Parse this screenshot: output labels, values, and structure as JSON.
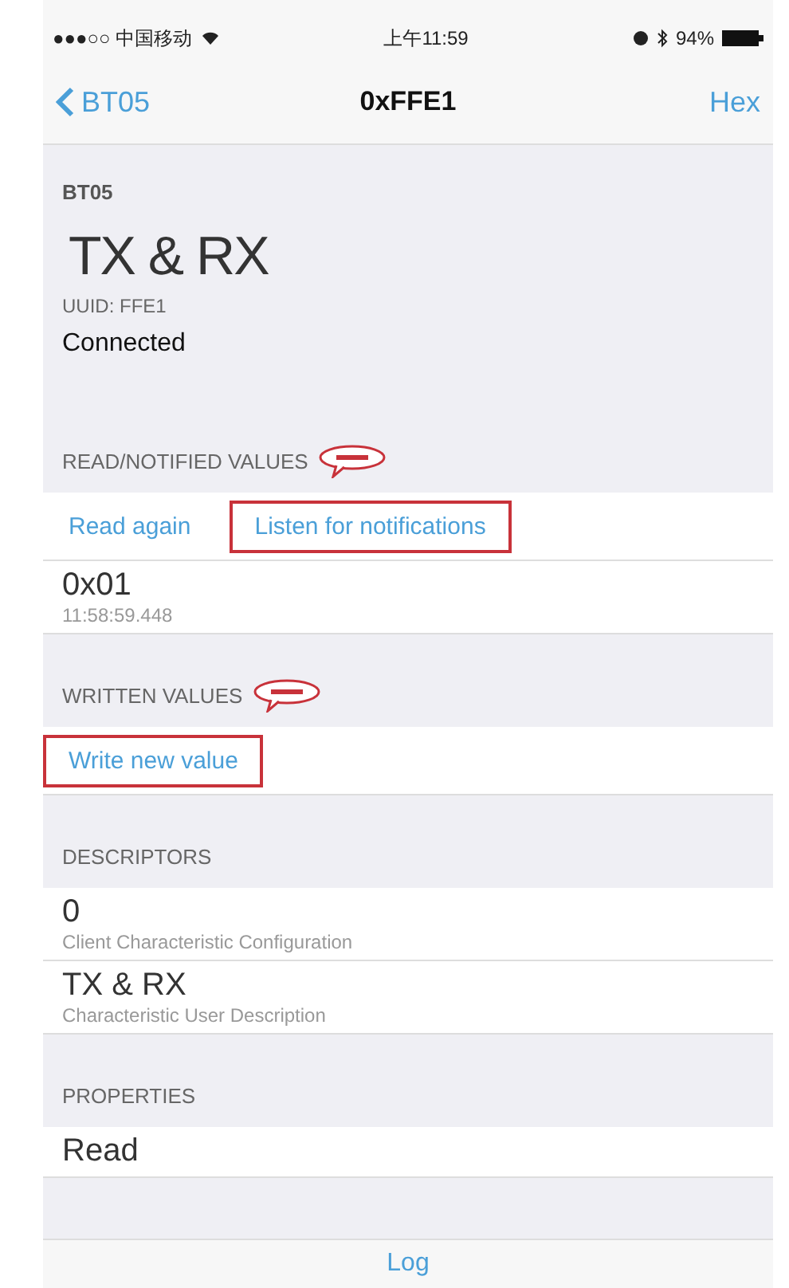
{
  "status_bar": {
    "carrier": "●●●○○ 中国移动",
    "time": "上午11:59",
    "battery": "94%"
  },
  "nav": {
    "back": "BT05",
    "title": "0xFFE1",
    "action": "Hex"
  },
  "header": {
    "device": "BT05",
    "name": "TX & RX",
    "uuid": "UUID: FFE1",
    "status": "Connected"
  },
  "sections": [
    {
      "title": "READ/NOTIFIED VALUES",
      "callout": true,
      "actions": [
        {
          "label": "Read again",
          "highlighted": false
        },
        {
          "label": "Listen for notifications",
          "highlighted": true
        }
      ],
      "rows": [
        {
          "value": "0x01",
          "detail": "11:58:59.448"
        }
      ]
    },
    {
      "title": "WRITTEN VALUES",
      "callout": true,
      "actions": [
        {
          "label": "Write new value",
          "highlighted": true
        }
      ]
    },
    {
      "title": "DESCRIPTORS",
      "rows": [
        {
          "value": "0",
          "detail": "Client Characteristic Configuration"
        },
        {
          "value": "TX & RX",
          "detail": "Characteristic User Description"
        }
      ]
    },
    {
      "title": "PROPERTIES",
      "rows": [
        {
          "value": "Read"
        }
      ]
    }
  ],
  "toolbar": {
    "label": "Log"
  }
}
